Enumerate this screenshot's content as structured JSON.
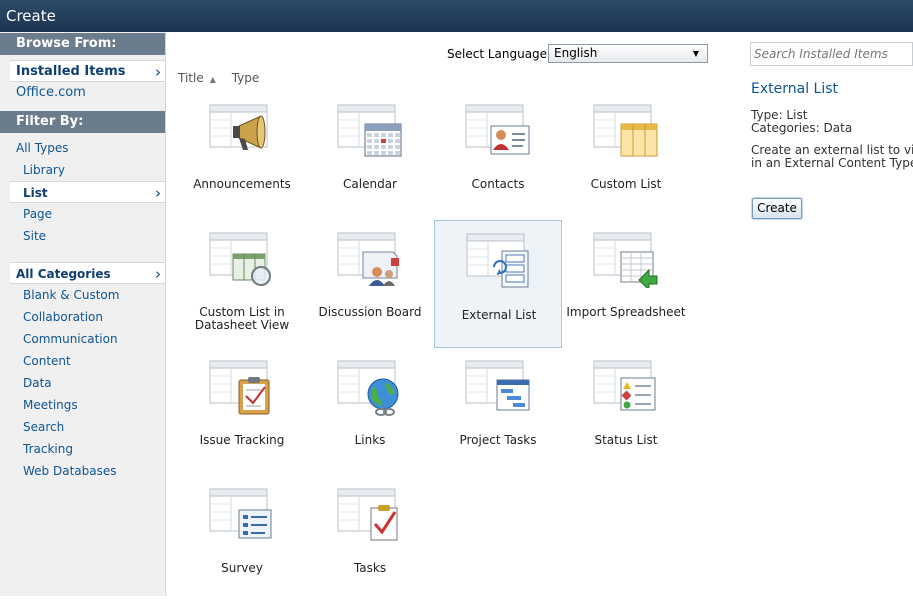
{
  "window": {
    "title": "Create"
  },
  "sidebar": {
    "browse_heading": "Browse From:",
    "browse_items": [
      {
        "label": "Installed Items",
        "selected": true
      },
      {
        "label": "Office.com",
        "selected": false
      }
    ],
    "filter_heading": "Filter By:",
    "type_items": [
      {
        "label": "All Types"
      },
      {
        "label": "Library"
      },
      {
        "label": "List"
      },
      {
        "label": "Page"
      },
      {
        "label": "Site"
      }
    ],
    "category_items": [
      {
        "label": "All Categories"
      },
      {
        "label": "Blank & Custom"
      },
      {
        "label": "Collaboration"
      },
      {
        "label": "Communication"
      },
      {
        "label": "Content"
      },
      {
        "label": "Data"
      },
      {
        "label": "Meetings"
      },
      {
        "label": "Search"
      },
      {
        "label": "Tracking"
      },
      {
        "label": "Web Databases"
      }
    ]
  },
  "language": {
    "label": "Select Language:",
    "selected": "English"
  },
  "sort": {
    "title_label": "Title",
    "type_label": "Type"
  },
  "templates": [
    {
      "label": "Announcements",
      "icon": "megaphone-icon"
    },
    {
      "label": "Calendar",
      "icon": "calendar-icon"
    },
    {
      "label": "Contacts",
      "icon": "contact-card-icon"
    },
    {
      "label": "Custom List",
      "icon": "custom-list-icon"
    },
    {
      "label": "Custom List in\nDatasheet View",
      "icon": "datasheet-magnifier-icon"
    },
    {
      "label": "Discussion Board",
      "icon": "discussion-board-icon"
    },
    {
      "label": "External List",
      "icon": "external-list-icon",
      "selected": true
    },
    {
      "label": "Import Spreadsheet",
      "icon": "import-spreadsheet-icon"
    },
    {
      "label": "Issue Tracking",
      "icon": "clipboard-icon"
    },
    {
      "label": "Links",
      "icon": "globe-link-icon"
    },
    {
      "label": "Project Tasks",
      "icon": "gantt-icon"
    },
    {
      "label": "Status List",
      "icon": "status-list-icon"
    },
    {
      "label": "Survey",
      "icon": "survey-icon"
    },
    {
      "label": "Tasks",
      "icon": "task-check-icon"
    }
  ],
  "details": {
    "search_placeholder": "Search Installed Items",
    "title": "External List",
    "type_line": "Type: List",
    "categories_line": "Categories: Data",
    "description_line1": "Create an external list to view",
    "description_line2": "in an External Content Type.",
    "create_label": "Create"
  },
  "colors": {
    "titlebar": "#1c3450",
    "section_heading": "#6b7c8c",
    "link": "#0f5591",
    "selected_tile_bg": "#eef3f8",
    "selected_tile_border": "#a8c4df"
  }
}
